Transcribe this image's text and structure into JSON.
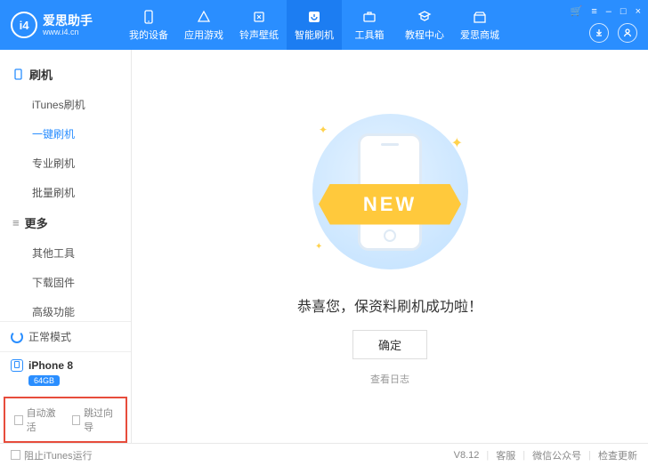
{
  "brand": {
    "name": "爱思助手",
    "url": "www.i4.cn",
    "logo_text": "i4"
  },
  "nav": {
    "items": [
      {
        "label": "我的设备"
      },
      {
        "label": "应用游戏"
      },
      {
        "label": "铃声壁纸"
      },
      {
        "label": "智能刷机"
      },
      {
        "label": "工具箱"
      },
      {
        "label": "教程中心"
      },
      {
        "label": "爱思商城"
      }
    ],
    "active_index": 3
  },
  "window_controls": {
    "cart": "🛒",
    "menu": "≡",
    "min": "–",
    "max": "□",
    "close": "×"
  },
  "sidebar": {
    "groups": [
      {
        "title": "刷机",
        "items": [
          "iTunes刷机",
          "一键刷机",
          "专业刷机",
          "批量刷机"
        ],
        "active_index": 1
      },
      {
        "title": "更多",
        "items": [
          "其他工具",
          "下载固件",
          "高级功能"
        ],
        "active_index": -1
      }
    ],
    "status": "正常模式",
    "device": {
      "name": "iPhone 8",
      "storage": "64GB"
    },
    "options": {
      "auto_activate": "自动激活",
      "skip_guide": "跳过向导"
    }
  },
  "main": {
    "ribbon": "NEW",
    "message": "恭喜您，保资料刷机成功啦！",
    "ok": "确定",
    "view_log": "查看日志"
  },
  "footer": {
    "block_itunes": "阻止iTunes运行",
    "version": "V8.12",
    "support": "客服",
    "wechat": "微信公众号",
    "update": "检查更新"
  }
}
